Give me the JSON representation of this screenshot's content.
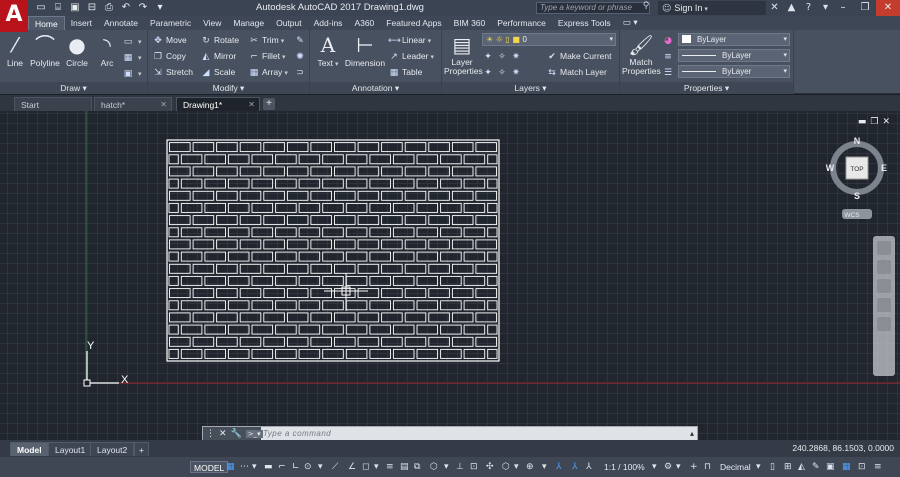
{
  "title_bar": {
    "app_logo": "A",
    "title": "Autodesk AutoCAD 2017    Drawing1.dwg",
    "search_placeholder": "Type a keyword or phrase",
    "sign_in": "Sign In",
    "qat_icons": [
      "new-icon",
      "open-icon",
      "save-icon",
      "saveas-icon",
      "plot-icon",
      "undo-icon",
      "redo-icon"
    ],
    "right_icons": [
      "exchange-icon",
      "a360-icon",
      "help-icon"
    ]
  },
  "ribbon_tabs": [
    "Home",
    "Insert",
    "Annotate",
    "Parametric",
    "View",
    "Manage",
    "Output",
    "Add-ins",
    "A360",
    "Featured Apps",
    "BIM 360",
    "Performance",
    "Express Tools"
  ],
  "active_ribbon_tab": "Home",
  "panels": {
    "draw": {
      "label": "Draw ▾",
      "tools": [
        "Line",
        "Polyline",
        "Circle",
        "Arc"
      ]
    },
    "modify": {
      "label": "Modify ▾",
      "tools": [
        [
          "Move",
          "Rotate",
          "Trim"
        ],
        [
          "Copy",
          "Mirror",
          "Fillet"
        ],
        [
          "Stretch",
          "Scale",
          "Array"
        ]
      ]
    },
    "annotation": {
      "label": "Annotation ▾",
      "text": "Text",
      "dimension": "Dimension",
      "linear": "Linear",
      "leader": "Leader",
      "table": "Table"
    },
    "layers": {
      "label": "Layers ▾",
      "layer_properties_1": "Layer",
      "layer_properties_2": "Properties",
      "current_layer": "0",
      "make_current": "Make Current",
      "match_layer": "Match Layer"
    },
    "properties": {
      "label": "Properties ▾",
      "match_1": "Match",
      "match_2": "Properties",
      "color": "ByLayer",
      "linetype": "ByLayer",
      "lineweight": "ByLayer"
    }
  },
  "file_tabs": [
    {
      "label": "Start",
      "active": false
    },
    {
      "label": "hatch*",
      "active": false
    },
    {
      "label": "Drawing1*",
      "active": true
    }
  ],
  "viewcube": {
    "north": "N",
    "south": "S",
    "east": "E",
    "west": "W",
    "face": "TOP",
    "ucs": "WCS"
  },
  "ucs_icon": {
    "x_label": "X",
    "y_label": "Y"
  },
  "command_line": {
    "placeholder": "Type a command"
  },
  "layout_tabs": [
    {
      "label": "Model",
      "active": true
    },
    {
      "label": "Layout1",
      "active": false
    },
    {
      "label": "Layout2",
      "active": false
    }
  ],
  "coordinates": "240.2868, 86.1503, 0.0000",
  "status_bar": {
    "model": "MODEL",
    "scale": "1:1 / 100%",
    "units": "Decimal"
  },
  "hatch": {
    "pattern": "brick",
    "rows": 18,
    "bricks_per_row": 14
  },
  "colors": {
    "x_axis": "#a3212b",
    "y_axis": "#2f7a3a",
    "accent": "#4ea1ff",
    "logo": "#b8121a"
  }
}
